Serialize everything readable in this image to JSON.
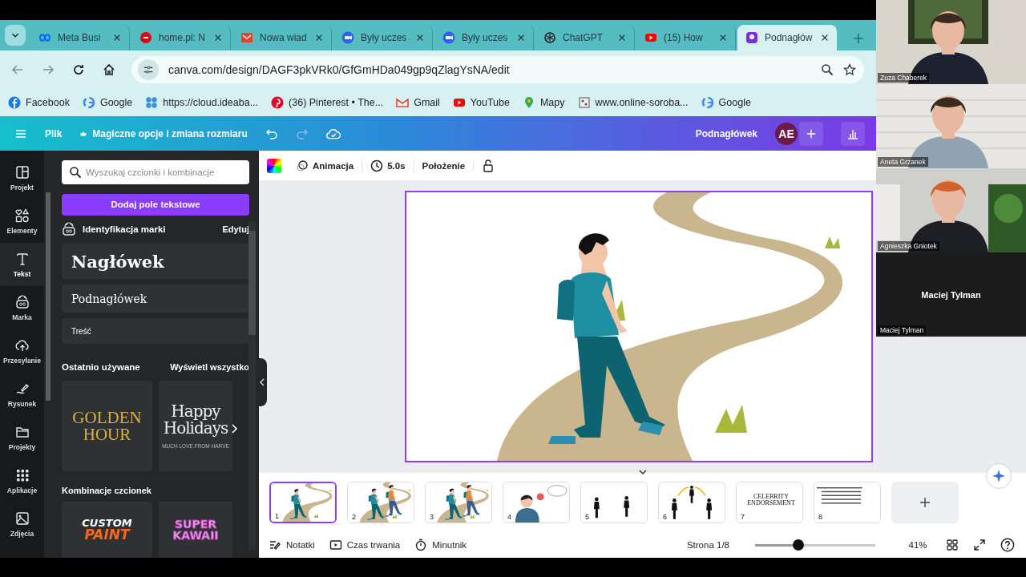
{
  "browser": {
    "tabs": [
      {
        "label": "Meta Busi",
        "selected": false
      },
      {
        "label": "home.pl: N",
        "selected": false
      },
      {
        "label": "Nowa wiad",
        "selected": false
      },
      {
        "label": "Były uczes",
        "selected": false
      },
      {
        "label": "Były uczes",
        "selected": false
      },
      {
        "label": "ChatGPT",
        "selected": false
      },
      {
        "label": "(15) How",
        "selected": false
      },
      {
        "label": "Podnagłów",
        "selected": true
      }
    ],
    "url": "canva.com/design/DAGF3pkVRk0/GfGmHDa049gp9qZlagYsNA/edit",
    "bookmarks": [
      "Facebook",
      "Google",
      "https://cloud.ideaba...",
      "(36) Pinterest • The...",
      "Gmail",
      "YouTube",
      "Mapy",
      "www.online-soroba...",
      "Google"
    ]
  },
  "editor": {
    "file_menu": "Plik",
    "magic_menu": "Magiczne opcje i zmiana rozmiaru",
    "title": "Podnagłówek",
    "avatar": "AE",
    "rail": [
      {
        "label": "Projekt",
        "selected": false
      },
      {
        "label": "Elementy",
        "selected": false
      },
      {
        "label": "Tekst",
        "selected": true
      },
      {
        "label": "Marka",
        "selected": false
      },
      {
        "label": "Przesyłanie",
        "selected": false
      },
      {
        "label": "Rysunek",
        "selected": false
      },
      {
        "label": "Projekty",
        "selected": false
      },
      {
        "label": "Aplikacje",
        "selected": false
      },
      {
        "label": "Zdjęcia",
        "selected": false
      }
    ],
    "panel": {
      "search_placeholder": "Wyszukaj czcionki i kombinacje",
      "add_button": "Dodaj pole tekstowe",
      "brand_title": "Identyfikacja marki",
      "brand_edit": "Edytuj",
      "text_styles": [
        {
          "label": "Nagłówek",
          "kind": "heading"
        },
        {
          "label": "Podnagłówek",
          "kind": "subheading"
        },
        {
          "label": "Treść",
          "kind": "body"
        }
      ],
      "recent_title": "Ostatnio używane",
      "recent_link": "Wyświetl wszystko",
      "recent": [
        {
          "lines": [
            "GOLDEN",
            "HOUR"
          ],
          "kind": "golden"
        },
        {
          "lines": [
            "Happy",
            "Holidays"
          ],
          "caption": "MUCH LOVE FROM HARVE",
          "kind": "holiday"
        }
      ],
      "combos_title": "Kombinacje czcionek",
      "combos": [
        {
          "lines": [
            "CUSTOM",
            "PAINT"
          ],
          "kind": "paint"
        },
        {
          "lines": [
            "SUPER",
            "KAWAII"
          ],
          "kind": "kawaii"
        }
      ]
    },
    "toolbar": {
      "animation": "Animacja",
      "duration": "5.0s",
      "position": "Położenie"
    },
    "pages": [
      {
        "number": "1",
        "kind": "road",
        "selected": true
      },
      {
        "number": "2",
        "kind": "road-pair",
        "selected": false
      },
      {
        "number": "3",
        "kind": "road-pair",
        "selected": false
      },
      {
        "number": "4",
        "kind": "portrait",
        "selected": false
      },
      {
        "number": "5",
        "kind": "pair",
        "selected": false
      },
      {
        "number": "6",
        "kind": "trio",
        "selected": false
      },
      {
        "number": "7",
        "kind": "title",
        "text": "CELEBRITY ENDORSEMENT",
        "selected": false
      },
      {
        "number": "8",
        "kind": "list",
        "selected": false
      }
    ],
    "footer": {
      "notes": "Notatki",
      "duration": "Czas trwania",
      "timer": "Minutnik",
      "page": "Strona 1/8",
      "zoom": {
        "level": 0.36,
        "reading": "41%"
      }
    }
  },
  "call": {
    "participants": [
      {
        "label": "Zuza Chaberek",
        "video": true
      },
      {
        "label": "Aneta Grzanek",
        "video": true
      },
      {
        "label": "Agnieszka Gniotek",
        "video": true
      },
      {
        "label": "Maciej Tylman",
        "display_name": "Maciej Tylman",
        "video": false
      }
    ]
  }
}
